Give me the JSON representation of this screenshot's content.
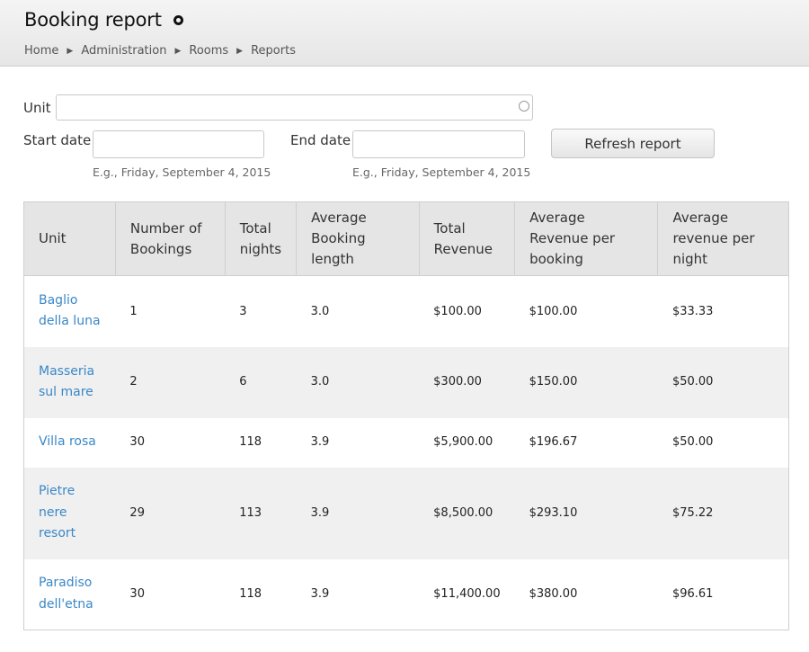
{
  "header": {
    "title": "Booking report",
    "breadcrumb": [
      "Home",
      "Administration",
      "Rooms",
      "Reports"
    ]
  },
  "filters": {
    "unit_label": "Unit",
    "unit_value": "",
    "start_label": "Start date",
    "start_value": "",
    "start_hint": "E.g., Friday, September 4, 2015",
    "end_label": "End date",
    "end_value": "",
    "end_hint": "E.g., Friday, September 4, 2015",
    "refresh_label": "Refresh report"
  },
  "table": {
    "headers": [
      "Unit",
      "Number of Bookings",
      "Total nights",
      "Average Booking length",
      "Total Revenue",
      "Average Revenue per booking",
      "Average revenue per night"
    ],
    "rows": [
      {
        "unit": "Baglio della luna",
        "bookings": "1",
        "nights": "3",
        "avg_length": "3.0",
        "revenue": "$100.00",
        "avg_rev_booking": "$100.00",
        "avg_rev_night": "$33.33"
      },
      {
        "unit": "Masseria sul mare",
        "bookings": "2",
        "nights": "6",
        "avg_length": "3.0",
        "revenue": "$300.00",
        "avg_rev_booking": "$150.00",
        "avg_rev_night": "$50.00"
      },
      {
        "unit": "Villa rosa",
        "bookings": "30",
        "nights": "118",
        "avg_length": "3.9",
        "revenue": "$5,900.00",
        "avg_rev_booking": "$196.67",
        "avg_rev_night": "$50.00"
      },
      {
        "unit": "Pietre nere resort",
        "bookings": "29",
        "nights": "113",
        "avg_length": "3.9",
        "revenue": "$8,500.00",
        "avg_rev_booking": "$293.10",
        "avg_rev_night": "$75.22"
      },
      {
        "unit": "Paradiso dell'etna",
        "bookings": "30",
        "nights": "118",
        "avg_length": "3.9",
        "revenue": "$11,400.00",
        "avg_rev_booking": "$380.00",
        "avg_rev_night": "$96.61"
      }
    ]
  },
  "colors": {
    "link": "#3a88c8",
    "header_bg": "#e5e5e5",
    "row_alt_bg": "#f0f0f0"
  }
}
